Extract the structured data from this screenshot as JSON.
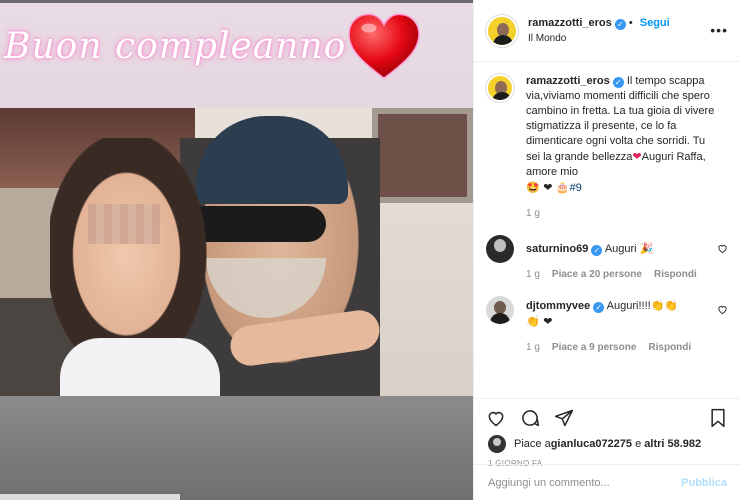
{
  "banner": {
    "text": "Buon compleanno"
  },
  "post": {
    "username": "ramazzotti_eros",
    "verified": "✓",
    "follow": "Segui",
    "location": "Il Mondo",
    "more": "•••"
  },
  "caption": {
    "username": "ramazzotti_eros",
    "text": "Il tempo scappa via,viviamo momenti difficili che spero cambino in fretta. La tua gioia di vivere stigmatizza il presente, ce lo fa dimenticare ogni volta che sorridi. Tu sei la grande bellezza",
    "text2": "Auguri Raffa, amore mio",
    "emojis": "🤩 ❤ 🎂",
    "hashtag": "#9",
    "age": "1 g"
  },
  "comments": [
    {
      "username": "saturnino69",
      "text": "Auguri",
      "emoji": "🎉",
      "age": "1 g",
      "likes": "Piace a 20 persone",
      "reply": "Rispondi"
    },
    {
      "username": "djtommyvee",
      "text": "Auguri!!!!",
      "emoji": "👏👏",
      "emoji2": "👏 ❤",
      "age": "1 g",
      "likes": "Piace a 9 persone",
      "reply": "Rispondi"
    }
  ],
  "likes_line": {
    "prefix": "Piace a ",
    "user": "gianluca072275",
    "suffix": " e ",
    "others": "altri 58.982"
  },
  "date": "1 GIORNO FA",
  "add_comment": {
    "placeholder": "Aggiungi un commento...",
    "publish": "Pubblica"
  },
  "icons": [
    "heart-icon",
    "comment-icon",
    "share-icon",
    "bookmark-icon",
    "more-options-icon",
    "verified-badge-icon"
  ]
}
